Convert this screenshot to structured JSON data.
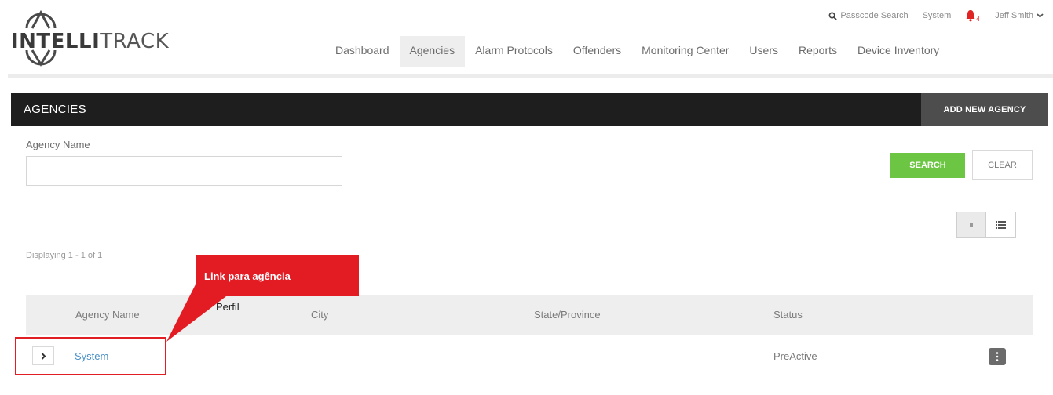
{
  "header": {
    "logo": {
      "text_bold": "INTELLI",
      "text_light": "TRACK"
    },
    "utility": {
      "search_label": "Passcode Search",
      "system_label": "System",
      "notification_count": "4",
      "user_label": "Jeff Smith"
    },
    "nav": [
      {
        "label": "Dashboard",
        "active": false
      },
      {
        "label": "Agencies",
        "active": true
      },
      {
        "label": "Alarm Protocols",
        "active": false
      },
      {
        "label": "Offenders",
        "active": false
      },
      {
        "label": "Monitoring Center",
        "active": false
      },
      {
        "label": "Users",
        "active": false
      },
      {
        "label": "Reports",
        "active": false
      },
      {
        "label": "Device Inventory",
        "active": false
      }
    ]
  },
  "panel": {
    "title": "AGENCIES",
    "add_button": "ADD NEW AGENCY"
  },
  "filter": {
    "agency_name_label": "Agency Name",
    "agency_name_value": "",
    "search_button": "SEARCH",
    "clear_button": "CLEAR"
  },
  "results": {
    "displaying": "Displaying 1 - 1 of 1",
    "columns": [
      "Agency Name",
      "City",
      "State/Province",
      "Status"
    ],
    "rows": [
      {
        "agency_name": "System",
        "city": "",
        "state": "",
        "status": "PreActive"
      }
    ]
  },
  "annotation": {
    "line1": "Link para agência",
    "line2": "Perfil",
    "color": "#e31c24"
  },
  "colors": {
    "accent_green": "#6cc644",
    "panel_dark": "#1e1e1e",
    "link_blue": "#4a90c8",
    "alert_red": "#e02424"
  }
}
